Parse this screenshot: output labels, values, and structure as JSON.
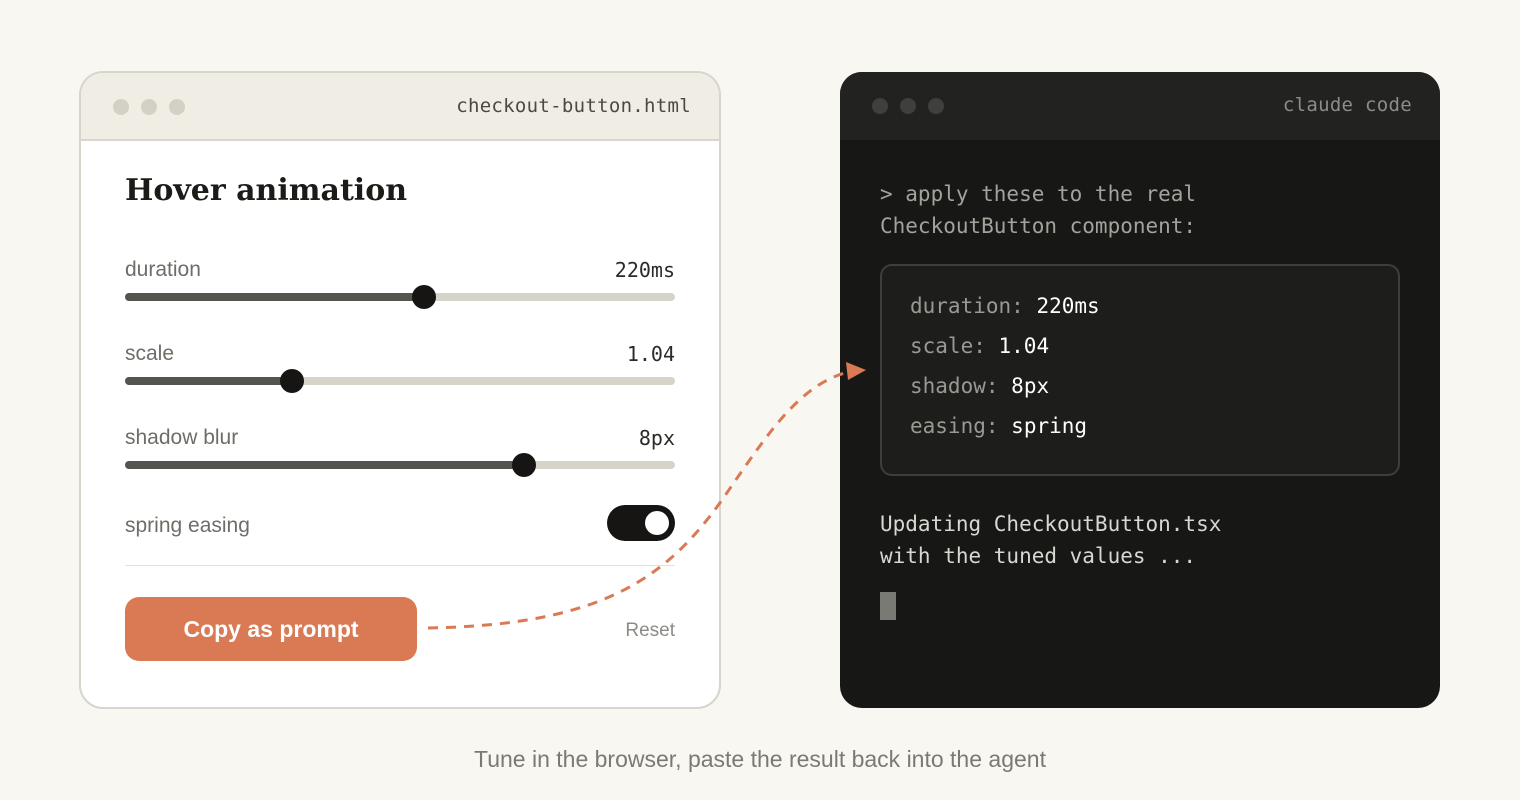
{
  "browser": {
    "filename": "checkout-button.html",
    "panel_title": "Hover animation",
    "controls": [
      {
        "label": "duration",
        "value": "220ms",
        "level": 0.544
      },
      {
        "label": "scale",
        "value": "1.04",
        "level": 0.304
      },
      {
        "label": "shadow blur",
        "value": "8px",
        "level": 0.725
      }
    ],
    "toggle": {
      "label": "spring easing",
      "on": true
    },
    "copy_button_label": "Copy as prompt",
    "reset_label": "Reset"
  },
  "terminal": {
    "title": "claude code",
    "prompt_lines": [
      "> apply these to the real",
      "CheckoutButton component:"
    ],
    "values": [
      {
        "key": "duration:",
        "val": "220ms"
      },
      {
        "key": "scale:",
        "val": "1.04"
      },
      {
        "key": "shadow:",
        "val": "8px"
      },
      {
        "key": "easing:",
        "val": "spring"
      }
    ],
    "status_lines": [
      "Updating CheckoutButton.tsx",
      "with the tuned values ..."
    ]
  },
  "caption": "Tune in the browser, paste the result back into the agent",
  "colors": {
    "accent": "#d97a55",
    "terminal_bg": "#171716",
    "browser_bar": "#efede4",
    "page_bg": "#f9f7f2"
  }
}
